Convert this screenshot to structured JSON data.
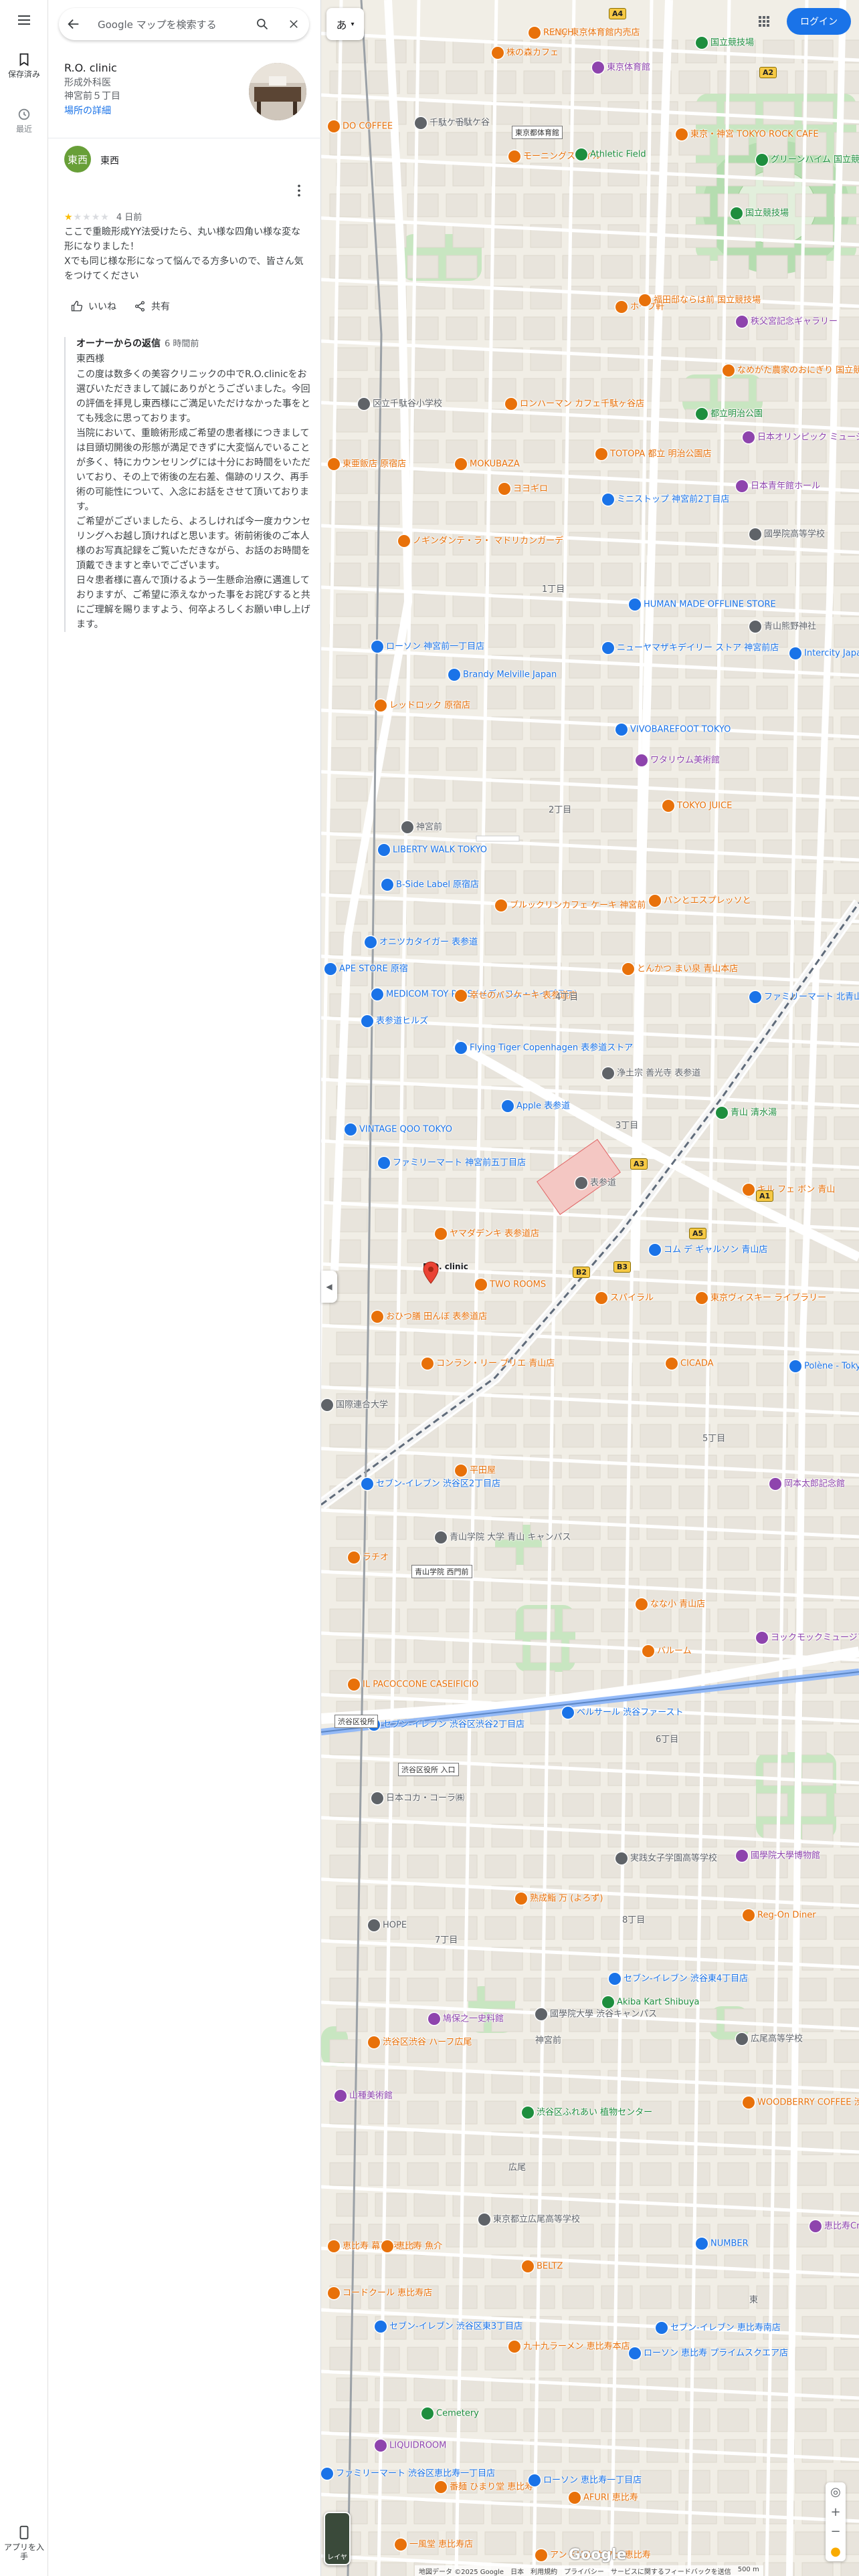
{
  "rail": {
    "saved_label": "保存済み",
    "recent_label": "最近",
    "get_app_label": "アプリを入手"
  },
  "search": {
    "placeholder": "Google マップを検索する"
  },
  "place": {
    "name": "R.O. clinic",
    "category": "形成外科医",
    "address": "神宮前５丁目",
    "details_link": "場所の詳細"
  },
  "review": {
    "avatar_initials": "東西",
    "reviewer_name": "東西",
    "stars_filled": 1,
    "stars_total": 5,
    "time": "4 日前",
    "text": "ここで重瞼形成YY法受けたら、丸い様な四角い様な変な形になりました！\nXでも同じ様な形になって悩んでる方多いので、皆さん気をつけてください",
    "like_label": "いいね",
    "share_label": "共有",
    "owner_reply_title": "オーナーからの返信",
    "owner_reply_time": "6 時間前",
    "owner_reply_to": "東西様",
    "owner_reply_text": "この度は数多くの美容クリニックの中でR.O.clinicをお選びいただきまして誠にありがとうございました。今回の評価を拝見し東西様にご満足いただけなかった事をとても残念に思っております。\n当院において、重瞼術形成ご希望の患者様につきましては目頭切開後の形態が満足できずに大変悩んでいることが多く、特にカウンセリングには十分にお時間をいただいており、その上で術後の左右差、傷跡のリスク、再手術の可能性について、入念にお話をさせて頂いております。\nご希望がございましたら、よろしければ今一度カウンセリングへお越し頂ければと思います。術前術後のご本人様のお写真記録をご覧いただきながら、お話のお時間を頂戴できますと幸いでございます。\n日々患者様に喜んで頂けるよう一生懸命治療に邁進しておりますが、ご希望に添えなかった事をお詫びすると共にご理解を賜りますよう、何卒よろしくお願い申し上げます。"
  },
  "header": {
    "login_label": "ログイン",
    "ime_label": "あ"
  },
  "map": {
    "selected_pin_label": "R.O. clinic",
    "google_logo": "Google",
    "footer": [
      "地図データ ©2025 Google",
      "日本",
      "利用規約",
      "プライバシー",
      "サービスに関するフィードバックを送信",
      "500 m"
    ],
    "layers_label": "レイヤ",
    "places": [
      {
        "name": "foody 東京体育館内売店",
        "color": "#e8710a"
      },
      {
        "name": "株の森カフェ",
        "color": "#e8710a"
      },
      {
        "name": "東京体育館",
        "color": "#8e44ad"
      },
      {
        "name": "国立競技場",
        "color": "#1e8e3e"
      },
      {
        "name": "DO COFFEE",
        "color": "#e8710a"
      },
      {
        "name": "千駄ケ谷",
        "color": "#5f6368"
      },
      {
        "name": "モーニングスマイル",
        "color": "#e8710a"
      },
      {
        "name": "Athletic Field",
        "color": "#1e8e3e"
      },
      {
        "name": "東京・神宮 TOKYO ROCK CAFE",
        "color": "#e8710a"
      },
      {
        "name": "グリーンハイム 国立競技場",
        "color": "#1e8e3e"
      },
      {
        "name": "国立競技場",
        "color": "#1e8e3e"
      },
      {
        "name": "ホープ軒",
        "color": "#e8710a"
      },
      {
        "name": "福田邸ならは前 国立競技場",
        "color": "#e8710a"
      },
      {
        "name": "なめがた農家のおにぎり 国立競技場店",
        "color": "#e8710a"
      },
      {
        "name": "秩父宮記念ギャラリー",
        "color": "#8e44ad"
      },
      {
        "name": "区立千駄谷小学校",
        "color": "#5f6368"
      },
      {
        "name": "ロンハーマン カフェ千駄ヶ谷店",
        "color": "#e8710a"
      },
      {
        "name": "都立明治公園",
        "color": "#1e8e3e"
      },
      {
        "name": "日本オリンピック ミュージアム",
        "color": "#8e44ad"
      },
      {
        "name": "東亜飯店 原宿店",
        "color": "#e8710a"
      },
      {
        "name": "MOKUBAZA",
        "color": "#e8710a"
      },
      {
        "name": "TOTOPA 都立 明治公園店",
        "color": "#e8710a"
      },
      {
        "name": "日本青年館ホール",
        "color": "#8e44ad"
      },
      {
        "name": "ヨヨギロ",
        "color": "#e8710a"
      },
      {
        "name": "ミニストップ 神宮前2丁目店",
        "color": "#1a73e8"
      },
      {
        "name": "國學院高等学校",
        "color": "#5f6368"
      },
      {
        "name": "ノギンダンテ・ラ・ マドリカンガーデ",
        "color": "#e8710a"
      },
      {
        "name": "HUMAN MADE OFFLINE STORE",
        "color": "#1a73e8"
      },
      {
        "name": "青山熊野神社",
        "color": "#5f6368"
      },
      {
        "name": "ローソン 神宮前一丁目店",
        "color": "#1a73e8"
      },
      {
        "name": "ニューヤマザキデイリー ストア 神宮前店",
        "color": "#1a73e8"
      },
      {
        "name": "Intercity Japan Hair Salon Tokyo",
        "color": "#1a73e8"
      },
      {
        "name": "Brandy Melville Japan",
        "color": "#1a73e8"
      },
      {
        "name": "レッドロック 原宿店",
        "color": "#e8710a"
      },
      {
        "name": "VIVOBAREFOOT TOKYO",
        "color": "#1a73e8"
      },
      {
        "name": "ワタリウム美術館",
        "color": "#8e44ad"
      },
      {
        "name": "TOKYO JUICE",
        "color": "#e8710a"
      },
      {
        "name": "神宮前",
        "color": "#5f6368"
      },
      {
        "name": "LIBERTY WALK TOKYO",
        "color": "#1a73e8"
      },
      {
        "name": "B-Side Label 原宿店",
        "color": "#1a73e8"
      },
      {
        "name": "ブルックリンカフェ ケーキ 神宮前",
        "color": "#e8710a"
      },
      {
        "name": "パンとエスプレッソと",
        "color": "#e8710a"
      },
      {
        "name": "オニツカタイガー 表参道",
        "color": "#1a73e8"
      },
      {
        "name": "とんかつ まい泉 青山本店",
        "color": "#e8710a"
      },
      {
        "name": "APE STORE 原宿",
        "color": "#1a73e8"
      },
      {
        "name": "MEDICOM TOY PLUS (メディコム・トイプラス)",
        "color": "#1a73e8"
      },
      {
        "name": "幸せのパンケーキ 表参道店",
        "color": "#e8710a"
      },
      {
        "name": "ファミリーマート 北青山三丁目店",
        "color": "#1a73e8"
      },
      {
        "name": "表参道ヒルズ",
        "color": "#1a73e8"
      },
      {
        "name": "Flying Tiger Copenhagen 表参道ストア",
        "color": "#1a73e8"
      },
      {
        "name": "浄土宗 善光寺 表参道",
        "color": "#5f6368"
      },
      {
        "name": "Apple 表参道",
        "color": "#1a73e8"
      },
      {
        "name": "青山 清水湯",
        "color": "#1e8e3e"
      },
      {
        "name": "VINTAGE QOO TOKYO",
        "color": "#1a73e8"
      },
      {
        "name": "ファミリーマート 神宮前五丁目店",
        "color": "#1a73e8"
      },
      {
        "name": "表参道",
        "color": "#5f6368"
      },
      {
        "name": "キル フェ ボン 青山",
        "color": "#e8710a"
      },
      {
        "name": "ヤマダデンキ 表参道店",
        "color": "#e8710a"
      },
      {
        "name": "コム デ ギャルソン 青山店",
        "color": "#1a73e8"
      },
      {
        "name": "TWO ROOMS",
        "color": "#e8710a"
      },
      {
        "name": "スパイラル",
        "color": "#e8710a"
      },
      {
        "name": "東京ヴィスキー ライブラリー",
        "color": "#e8710a"
      },
      {
        "name": "おひつ膳 田んぼ 表参道店",
        "color": "#e8710a"
      },
      {
        "name": "コンラン・リー プリエ 青山店",
        "color": "#e8710a"
      },
      {
        "name": "CICADA",
        "color": "#e8710a"
      },
      {
        "name": "Polène - Tokyo",
        "color": "#1a73e8"
      },
      {
        "name": "国際連合大学",
        "color": "#5f6368"
      },
      {
        "name": "平田屋",
        "color": "#e8710a"
      },
      {
        "name": "岡本太郎記念館",
        "color": "#8e44ad"
      },
      {
        "name": "セブン-イレブン 渋谷区2丁目店",
        "color": "#1a73e8"
      },
      {
        "name": "青山学院 大学 青山 キャンパス",
        "color": "#5f6368"
      },
      {
        "name": "ラチオ",
        "color": "#e8710a"
      },
      {
        "name": "なな小 青山店",
        "color": "#e8710a"
      },
      {
        "name": "ヨックモックミュージアム",
        "color": "#8e44ad"
      },
      {
        "name": "バルーム",
        "color": "#e8710a"
      },
      {
        "name": "IL PACOCCONE CASEIFICIO",
        "color": "#e8710a"
      },
      {
        "name": "セブン-イレブン 渋谷区渋谷2丁目店",
        "color": "#1a73e8"
      },
      {
        "name": "ベルサール 渋谷ファースト",
        "color": "#1a73e8"
      },
      {
        "name": "日本コカ・コーラ㈱",
        "color": "#5f6368"
      },
      {
        "name": "実践女子学園高等学校",
        "color": "#5f6368"
      },
      {
        "name": "國學院大學博物館",
        "color": "#8e44ad"
      },
      {
        "name": "熟成鮨 万 (よろず)",
        "color": "#e8710a"
      },
      {
        "name": "HOPE",
        "color": "#5f6368"
      },
      {
        "name": "Reg-On Diner",
        "color": "#e8710a"
      },
      {
        "name": "セブン-イレブン 渋谷東4丁目店",
        "color": "#1a73e8"
      },
      {
        "name": "Akiba Kart Shibuya",
        "color": "#1e8e3e"
      },
      {
        "name": "國學院大學 渋谷キャンパス",
        "color": "#5f6368"
      },
      {
        "name": "鳩保之一史料館",
        "color": "#8e44ad"
      },
      {
        "name": "広尾高等学校",
        "color": "#5f6368"
      },
      {
        "name": "渋谷区渋谷 ハーフ広尾",
        "color": "#e8710a"
      },
      {
        "name": "WOODBERRY COFFEE 渋谷店",
        "color": "#e8710a"
      },
      {
        "name": "山種美術館",
        "color": "#8e44ad"
      },
      {
        "name": "渋谷区ふれあい 植物センター",
        "color": "#1e8e3e"
      },
      {
        "name": "東京都立広尾高等学校",
        "color": "#5f6368"
      },
      {
        "name": "恵比寿 幕蔵 えびす",
        "color": "#e8710a"
      },
      {
        "name": "恵比寿 魚介",
        "color": "#e8710a"
      },
      {
        "name": "恵比寿Creato",
        "color": "#8e44ad"
      },
      {
        "name": "NUMBER",
        "color": "#1a73e8"
      },
      {
        "name": "BELTZ",
        "color": "#e8710a"
      },
      {
        "name": "コードクール 恵比寿店",
        "color": "#e8710a"
      },
      {
        "name": "セブン-イレブン 渋谷区東3丁目店",
        "color": "#1a73e8"
      },
      {
        "name": "セブン-イレブン 恵比寿南店",
        "color": "#1a73e8"
      },
      {
        "name": "ローソン 恵比寿 プライムスクエア店",
        "color": "#1a73e8"
      },
      {
        "name": "九十九ラーメン 恵比寿本店",
        "color": "#e8710a"
      },
      {
        "name": "Cemetery",
        "color": "#1e8e3e"
      },
      {
        "name": "LIQUIDROOM",
        "color": "#8e44ad"
      },
      {
        "name": "番麺 ひまり堂 恵比寿",
        "color": "#e8710a"
      },
      {
        "name": "ローソン 恵比寿一丁目店",
        "color": "#1a73e8"
      },
      {
        "name": "AFURI 恵比寿",
        "color": "#e8710a"
      },
      {
        "name": "一風堂 恵比寿店",
        "color": "#e8710a"
      },
      {
        "name": "アンドリル カフェ 恵比寿",
        "color": "#e8710a"
      },
      {
        "name": "ファミリーマート 渋谷区恵比寿一丁目店",
        "color": "#1a73e8"
      },
      {
        "name": "RENCH",
        "color": "#e8710a"
      }
    ],
    "areas": [
      "千駄ケ谷",
      "1丁目",
      "2丁目",
      "3丁目",
      "4丁目",
      "5丁目",
      "6丁目",
      "7丁目",
      "8丁目",
      "神宮前",
      "東",
      "広尾"
    ],
    "station_badges": [
      "A4",
      "A2",
      "A3",
      "A5",
      "B2",
      "B3",
      "A1"
    ],
    "info_boxes": [
      "東京都体育館",
      "青山学院 西門前",
      "渋谷区役所",
      "渋谷区役所 入口"
    ]
  }
}
